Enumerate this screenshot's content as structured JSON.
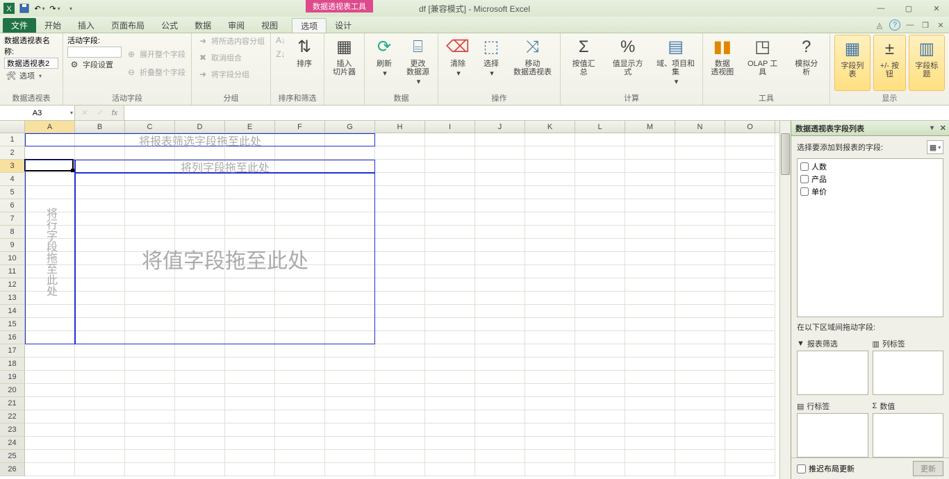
{
  "titlebar": {
    "context_tool": "数据透视表工具",
    "title": "df  [兼容模式] - Microsoft Excel"
  },
  "qat": {
    "save": "保存",
    "undo": "撤销",
    "redo": "重做"
  },
  "win": {
    "min": "最小化",
    "max": "最大化",
    "close": "关闭"
  },
  "tabs": {
    "file": "文件",
    "home": "开始",
    "insert": "插入",
    "layout": "页面布局",
    "formulas": "公式",
    "data": "数据",
    "review": "审阅",
    "view": "视图",
    "options": "选项",
    "design": "设计"
  },
  "ribbon": {
    "g1": {
      "name_label": "数据透视表名称:",
      "name_value": "数据透视表2",
      "options": "选项",
      "group_label": "数据透视表"
    },
    "g2": {
      "active_label": "活动字段:",
      "field_settings": "字段设置",
      "expand": "展开整个字段",
      "collapse": "折叠整个字段",
      "group_label": "活动字段"
    },
    "g3": {
      "group_sel": "将所选内容分组",
      "ungroup": "取消组合",
      "group_field": "将字段分组",
      "group_label": "分组"
    },
    "g4": {
      "sort": "排序",
      "group_label": "排序和筛选"
    },
    "g5": {
      "slicer": "插入\n切片器"
    },
    "g6": {
      "refresh": "刷新",
      "change": "更改\n数据源",
      "group_label": "数据"
    },
    "g7": {
      "clear": "清除",
      "select": "选择",
      "move": "移动\n数据透视表",
      "group_label": "操作"
    },
    "g8": {
      "summary": "按值汇总",
      "show": "值显示方式",
      "fields": "域、项目和\n集",
      "group_label": "计算"
    },
    "g9": {
      "chart": "数据\n透视图",
      "olap": "OLAP 工具",
      "whatif": "模拟分析",
      "group_label": "工具"
    },
    "g10": {
      "fieldlist": "字段列表",
      "pm": "+/- 按钮",
      "headers": "字段标题",
      "group_label": "显示"
    }
  },
  "namebox": "A3",
  "columns": [
    "A",
    "B",
    "C",
    "D",
    "E",
    "F",
    "G",
    "H",
    "I",
    "J",
    "K",
    "L",
    "M",
    "N",
    "O"
  ],
  "rows_count": 26,
  "pivot": {
    "filter_hint": "将报表筛选字段拖至此处",
    "col_hint": "将列字段拖至此处",
    "row_hint": "将行字段拖至此处",
    "val_hint": "将值字段拖至此处"
  },
  "pane": {
    "title": "数据透视表字段列表",
    "choose": "选择要添加到报表的字段:",
    "fields": [
      "人数",
      "产品",
      "单价"
    ],
    "areas_label": "在以下区域间拖动字段:",
    "filter": "报表筛选",
    "cols": "列标签",
    "rows": "行标签",
    "vals": "数值",
    "defer": "推迟布局更新",
    "update": "更新"
  }
}
